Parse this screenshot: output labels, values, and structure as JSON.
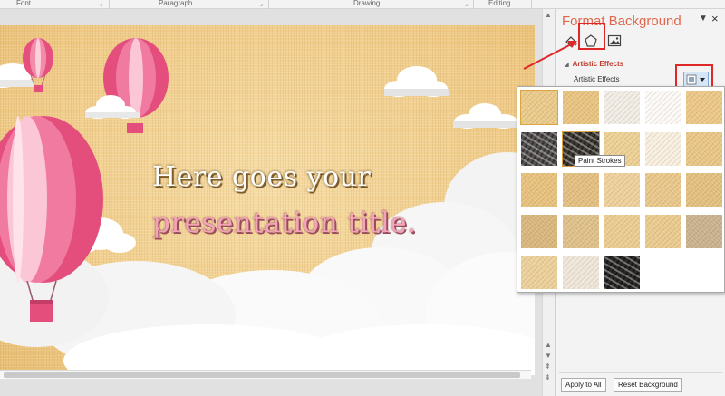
{
  "ribbon": {
    "groups": [
      "Font",
      "Paragraph",
      "Drawing",
      "Editing"
    ]
  },
  "slide": {
    "title_line1": "Here goes your",
    "title_line2": "presentation title."
  },
  "pane": {
    "title": "Format Background",
    "close_icon": "close-icon",
    "tabs": [
      {
        "name": "fill",
        "icon": "paint-bucket-icon"
      },
      {
        "name": "effects",
        "icon": "pentagon-icon",
        "selected": true
      },
      {
        "name": "picture",
        "icon": "picture-icon"
      }
    ],
    "section": "Artistic Effects",
    "row_label": "Artistic Effects",
    "buttons": {
      "apply_all": "Apply to All",
      "reset": "Reset Background"
    }
  },
  "gallery": {
    "tooltip": "Paint Strokes",
    "hovered_index": 6,
    "selected_index": 0,
    "thumbnails": [
      "#e9c987",
      "#e8c27e",
      "#f0ece6",
      "#fbfaf8",
      "#ebc685",
      "#555050",
      "#3e3a33",
      "#eccf92",
      "#f7efe0",
      "#e8c584",
      "#e6c07a",
      "#e2bd7e",
      "#edd09a",
      "#e8c688",
      "#e2be7d",
      "#d8b57a",
      "#ddbf87",
      "#eacb8f",
      "#e9c98c",
      "#c8b08c",
      "#ebcf98",
      "#eee6da",
      "#2b2826"
    ]
  },
  "colors": {
    "accent": "#e0674d",
    "highlight": "#e02727",
    "slide_bg": "#f1cf8b",
    "balloon_pink": "#e34e7d"
  }
}
